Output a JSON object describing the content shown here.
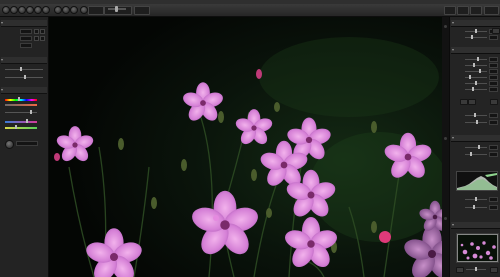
{
  "app": {
    "title": ""
  },
  "left_panel": {
    "sections": [
      {
        "label": ""
      },
      {
        "label": ""
      },
      {
        "label": ""
      }
    ]
  },
  "right_panel": {
    "sections": [
      {
        "label": ""
      },
      {
        "label": ""
      },
      {
        "label": ""
      },
      {
        "label": ""
      }
    ]
  },
  "photo": {
    "subject": "pink flowers",
    "background_color": "#050806",
    "flower_color": "#d986d9"
  },
  "colors": {
    "panel_bg": "#242424",
    "toolbar_bg": "#2e2e2e",
    "accent_white": "#eaeaea"
  }
}
